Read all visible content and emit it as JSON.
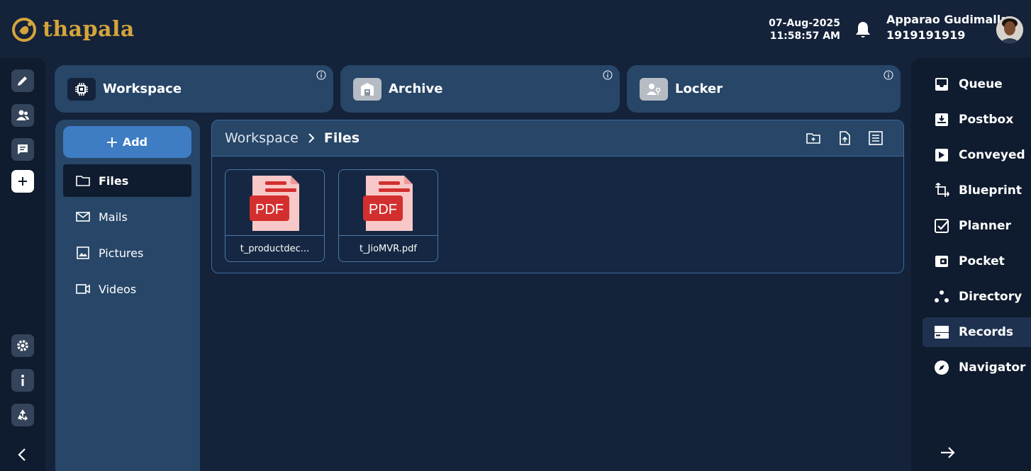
{
  "brand": {
    "name": "thapala"
  },
  "header": {
    "date": "07-Aug-2025",
    "time": "11:58:57 AM",
    "user_name": "Apparao Gudimalla",
    "user_phone": "1919191919"
  },
  "tabs": [
    {
      "label": "Workspace",
      "icon": "chip-icon"
    },
    {
      "label": "Archive",
      "icon": "archive-box-icon"
    },
    {
      "label": "Locker",
      "icon": "user-key-icon"
    }
  ],
  "left_nav": {
    "add_label": "Add",
    "items": [
      {
        "label": "Files",
        "icon": "folder-icon",
        "active": true
      },
      {
        "label": "Mails",
        "icon": "mail-icon"
      },
      {
        "label": "Pictures",
        "icon": "image-icon"
      },
      {
        "label": "Videos",
        "icon": "video-icon"
      }
    ]
  },
  "breadcrumb": {
    "root": "Workspace",
    "current": "Files"
  },
  "files": [
    {
      "name": "t_productdec...",
      "type_badge": "PDF"
    },
    {
      "name": "t_JioMVR.pdf",
      "type_badge": "PDF"
    }
  ],
  "right_nav": [
    {
      "label": "Queue",
      "icon": "inbox-icon"
    },
    {
      "label": "Postbox",
      "icon": "postbox-icon"
    },
    {
      "label": "Conveyed",
      "icon": "send-icon"
    },
    {
      "label": "Blueprint",
      "icon": "blueprint-icon"
    },
    {
      "label": "Planner",
      "icon": "checkbox-icon"
    },
    {
      "label": "Pocket",
      "icon": "wallet-icon"
    },
    {
      "label": "Directory",
      "icon": "directory-icon"
    },
    {
      "label": "Records",
      "icon": "records-icon",
      "active": true
    },
    {
      "label": "Navigator",
      "icon": "compass-icon"
    }
  ],
  "colors": {
    "background": "#14223a",
    "panel": "#274668",
    "accent": "#3e7cc4",
    "brand": "#d4a53a",
    "pdf_red": "#d32f2f"
  }
}
